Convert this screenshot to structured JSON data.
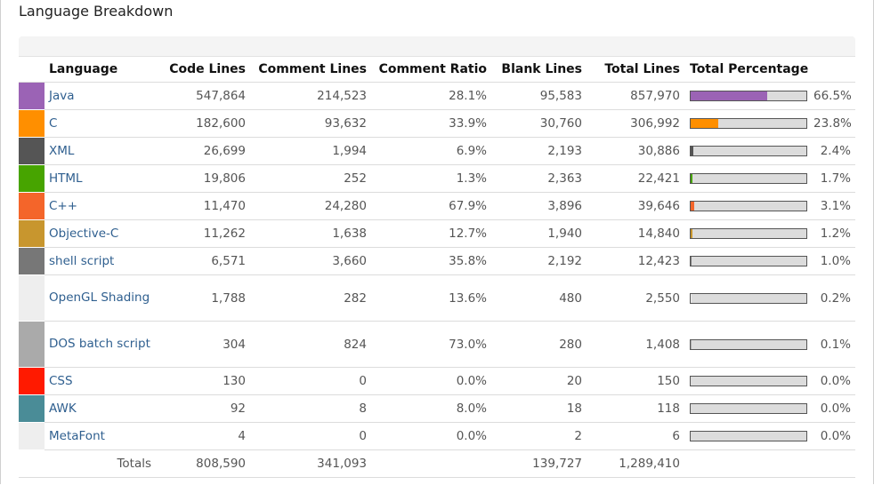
{
  "title": "Language Breakdown",
  "columns": {
    "language": "Language",
    "code": "Code Lines",
    "comment": "Comment Lines",
    "ratio": "Comment Ratio",
    "blank": "Blank Lines",
    "total": "Total Lines",
    "percentage": "Total Percentage"
  },
  "rows": [
    {
      "name": "Java",
      "color": "#9b63b5",
      "code": "547,864",
      "comment": "214,523",
      "ratio": "28.1%",
      "blank": "95,583",
      "total": "857,970",
      "pct": "66.5%",
      "pct_value": 66.5
    },
    {
      "name": "C",
      "color": "#ff8f00",
      "code": "182,600",
      "comment": "93,632",
      "ratio": "33.9%",
      "blank": "30,760",
      "total": "306,992",
      "pct": "23.8%",
      "pct_value": 23.8
    },
    {
      "name": "XML",
      "color": "#555555",
      "code": "26,699",
      "comment": "1,994",
      "ratio": "6.9%",
      "blank": "2,193",
      "total": "30,886",
      "pct": "2.4%",
      "pct_value": 2.4
    },
    {
      "name": "HTML",
      "color": "#47a400",
      "code": "19,806",
      "comment": "252",
      "ratio": "1.3%",
      "blank": "2,363",
      "total": "22,421",
      "pct": "1.7%",
      "pct_value": 1.7
    },
    {
      "name": "C++",
      "color": "#f4652a",
      "code": "11,470",
      "comment": "24,280",
      "ratio": "67.9%",
      "blank": "3,896",
      "total": "39,646",
      "pct": "3.1%",
      "pct_value": 3.1
    },
    {
      "name": "Objective-C",
      "color": "#c8962e",
      "code": "11,262",
      "comment": "1,638",
      "ratio": "12.7%",
      "blank": "1,940",
      "total": "14,840",
      "pct": "1.2%",
      "pct_value": 1.2
    },
    {
      "name": "shell script",
      "color": "#777777",
      "code": "6,571",
      "comment": "3,660",
      "ratio": "35.8%",
      "blank": "2,192",
      "total": "12,423",
      "pct": "1.0%",
      "pct_value": 1.0
    },
    {
      "name": "OpenGL Shading",
      "color": "#eeeeee",
      "code": "1,788",
      "comment": "282",
      "ratio": "13.6%",
      "blank": "480",
      "total": "2,550",
      "pct": "0.2%",
      "pct_value": 0.2,
      "tall": true
    },
    {
      "name": "DOS batch script",
      "color": "#aaaaaa",
      "code": "304",
      "comment": "824",
      "ratio": "73.0%",
      "blank": "280",
      "total": "1,408",
      "pct": "0.1%",
      "pct_value": 0.1,
      "tall": true
    },
    {
      "name": "CSS",
      "color": "#ff1a00",
      "code": "130",
      "comment": "0",
      "ratio": "0.0%",
      "blank": "20",
      "total": "150",
      "pct": "0.0%",
      "pct_value": 0.0
    },
    {
      "name": "AWK",
      "color": "#4a8c97",
      "code": "92",
      "comment": "8",
      "ratio": "8.0%",
      "blank": "18",
      "total": "118",
      "pct": "0.0%",
      "pct_value": 0.0
    },
    {
      "name": "MetaFont",
      "color": "#eeeeee",
      "code": "4",
      "comment": "0",
      "ratio": "0.0%",
      "blank": "2",
      "total": "6",
      "pct": "0.0%",
      "pct_value": 0.0
    }
  ],
  "totals": {
    "label": "Totals",
    "code": "808,590",
    "comment": "341,093",
    "blank": "139,727",
    "total": "1,289,410"
  }
}
